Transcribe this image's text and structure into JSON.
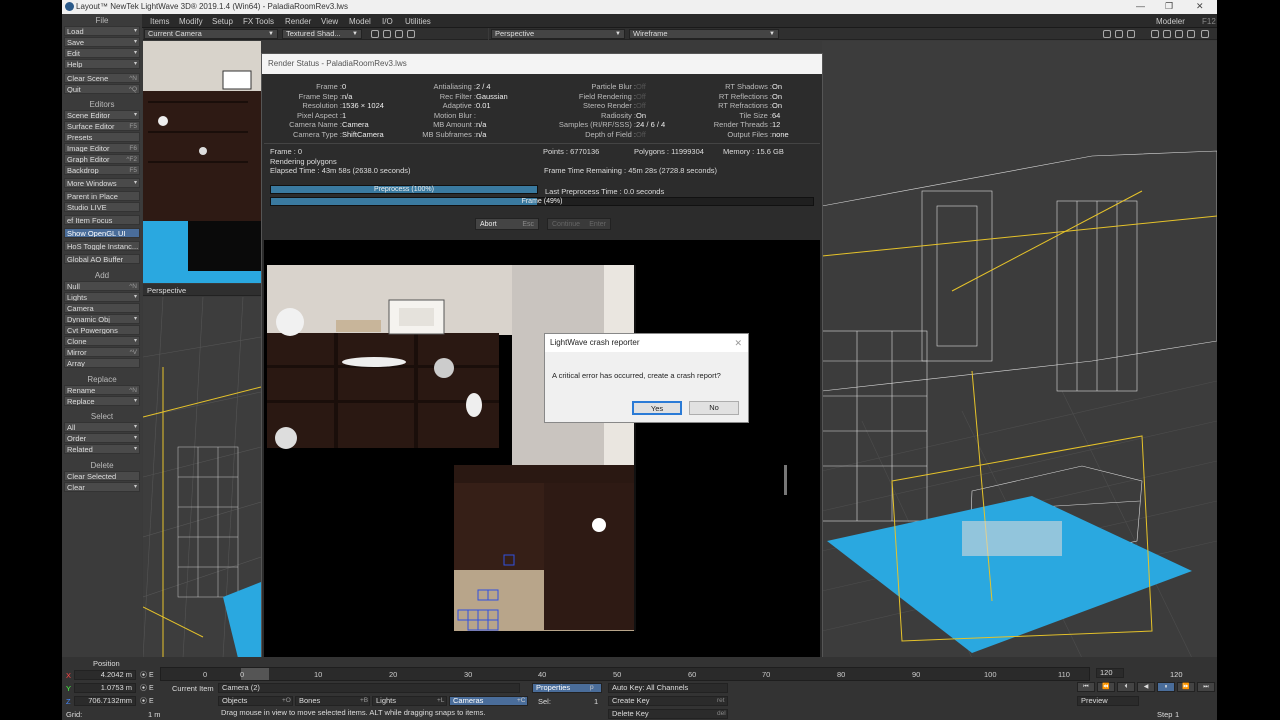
{
  "window": {
    "title": "Layout™ NewTek LightWave 3D® 2019.1.4 (Win64) - PaladiaRoomRev3.lws",
    "controls": [
      "—",
      "❐",
      "✕"
    ]
  },
  "menu": {
    "tabs": [
      "Items",
      "Modify",
      "Setup",
      "FX Tools",
      "Render",
      "View",
      "Model",
      "I/O",
      "Utilities"
    ],
    "active_tab": "Items",
    "modeler_label": "Modeler",
    "modeler_key": "F12"
  },
  "sidebar": {
    "file_title": "File",
    "file_items": [
      {
        "label": "Load",
        "key": "▾"
      },
      {
        "label": "Save",
        "key": "▾"
      },
      {
        "label": "Edit",
        "key": "▾"
      },
      {
        "label": "Help",
        "key": "▾"
      }
    ],
    "clear_scene": {
      "label": "Clear Scene",
      "key": "^N"
    },
    "quit": {
      "label": "Quit",
      "key": "^Q"
    },
    "editors_title": "Editors",
    "editor_items": [
      {
        "label": "Scene Editor",
        "key": "▾"
      },
      {
        "label": "Surface Editor",
        "key": "F5"
      },
      {
        "label": "Presets",
        "key": ""
      },
      {
        "label": "Image Editor",
        "key": "F6"
      },
      {
        "label": "Graph Editor",
        "key": "^F2"
      },
      {
        "label": "Backdrop",
        "key": "F5"
      },
      {
        "label": "More Windows",
        "key": "▾"
      }
    ],
    "misc_items": [
      {
        "label": "Parent in Place",
        "key": ""
      },
      {
        "label": "Studio LIVE",
        "key": ""
      },
      {
        "label": "ef Item Focus",
        "key": ""
      },
      {
        "label": "Show OpenGL UI",
        "key": ""
      },
      {
        "label": "HoS Toggle Instanc...",
        "key": ""
      },
      {
        "label": "Global AO Buffer",
        "key": ""
      }
    ],
    "add_title": "Add",
    "add_items": [
      {
        "label": "Null",
        "key": "^N"
      },
      {
        "label": "Lights",
        "key": "▾"
      },
      {
        "label": "Camera",
        "key": ""
      },
      {
        "label": "Dynamic Obj",
        "key": "▾"
      },
      {
        "label": "Cvt Powergons",
        "key": ""
      },
      {
        "label": "Clone",
        "key": "▾"
      },
      {
        "label": "Mirror",
        "key": "^V"
      },
      {
        "label": "Array",
        "key": ""
      }
    ],
    "replace_title": "Replace",
    "replace_items": [
      {
        "label": "Rename",
        "key": "^N"
      },
      {
        "label": "Replace",
        "key": "▾"
      }
    ],
    "select_title": "Select",
    "select_items": [
      {
        "label": "All",
        "key": "▾"
      },
      {
        "label": "Order",
        "key": "▾"
      },
      {
        "label": "Related",
        "key": "▾"
      }
    ],
    "delete_title": "Delete",
    "delete_items": [
      {
        "label": "Clear Selected",
        "key": ""
      },
      {
        "label": "Clear",
        "key": "▾"
      }
    ]
  },
  "viewports": {
    "top_left_view": "Current Camera",
    "top_left_shading": "Textured Shad...",
    "bottom_left_view": "Perspective",
    "right_view": "Perspective",
    "right_shading": "Wireframe"
  },
  "render_status": {
    "title": "Render Status - PaladiaRoomRev3.lws",
    "col1": [
      {
        "k": "Frame :",
        "v": "0"
      },
      {
        "k": "Frame Step :",
        "v": "n/a"
      },
      {
        "k": "Resolution :",
        "v": "1536 × 1024"
      },
      {
        "k": "Pixel Aspect :",
        "v": "1"
      },
      {
        "k": "Camera Name :",
        "v": "Camera"
      },
      {
        "k": "Camera Type :",
        "v": "ShiftCamera"
      }
    ],
    "col2": [
      {
        "k": "Antialiasing :",
        "v": "2 / 4"
      },
      {
        "k": "Rec Filter :",
        "v": "Gaussian"
      },
      {
        "k": "Adaptive :",
        "v": "0.01"
      },
      {
        "k": "Motion Blur :",
        "v": ""
      },
      {
        "k": "MB Amount :",
        "v": "n/a"
      },
      {
        "k": "MB Subframes :",
        "v": "n/a"
      }
    ],
    "col3": [
      {
        "k": "Particle Blur :",
        "v": "Off"
      },
      {
        "k": "Field Rendering :",
        "v": "Off"
      },
      {
        "k": "Stereo Render :",
        "v": "Off"
      },
      {
        "k": "Radiosity :",
        "v": "On"
      },
      {
        "k": "Samples (RI/RF/SSS) :",
        "v": "24 / 6 / 4"
      },
      {
        "k": "Depth of Field :",
        "v": "Off"
      }
    ],
    "col4": [
      {
        "k": "RT Shadows :",
        "v": "On"
      },
      {
        "k": "RT Reflections :",
        "v": "On"
      },
      {
        "k": "RT Refractions :",
        "v": "On"
      },
      {
        "k": "Tile Size :",
        "v": "64"
      },
      {
        "k": "Render Threads :",
        "v": "12"
      },
      {
        "k": "Output Files :",
        "v": "none"
      }
    ],
    "frame_line": "Frame : 0",
    "points": "Points : 6770136",
    "polygons": "Polygons : 11999304",
    "memory": "Memory : 15.6 GB",
    "stage": "Rendering polygons",
    "elapsed": "Elapsed Time : 43m 58s (2638.0 seconds)",
    "remaining": "Frame Time Remaining : 45m 28s (2728.8 seconds)",
    "last_preprocess": "Last Preprocess Time : 0.0 seconds",
    "preprocess_label": "Preprocess (100%)",
    "preprocess_progress": 1.0,
    "frame_label": "Frame (49%)",
    "frame_progress": 0.49,
    "abort_label": "Abort",
    "abort_key": "Esc",
    "continue_label": "Continue",
    "continue_key": "Enter"
  },
  "crash_dialog": {
    "title": "LightWave crash reporter",
    "message": "A critical error has occurred, create a crash report?",
    "yes_label": "Yes",
    "no_label": "No"
  },
  "bottom": {
    "position_label": "Position",
    "x_axis": "X",
    "y_axis": "Y",
    "z_axis": "Z",
    "x_value": "4.2042 m",
    "y_value": "1.0753 m",
    "z_value": "706.7132mm",
    "grid_label": "Grid:",
    "grid_value": "1 m",
    "current_item_label": "Current Item",
    "current_item_value": "Camera (2)",
    "objects_label": "Objects",
    "objects_key": "+O",
    "bones_label": "Bones",
    "bones_key": "+B",
    "lights_label": "Lights",
    "lights_key": "+L",
    "cameras_label": "Cameras",
    "cameras_key": "+C",
    "properties_label": "Properties",
    "properties_key": "p",
    "sel_label": "Sel:",
    "sel_value": "1",
    "autokey_label": "Auto Key: All Channels",
    "create_key_label": "Create Key",
    "create_key_key": "ret",
    "delete_key_label": "Delete Key",
    "delete_key_key": "del",
    "status_msg": "Drag mouse in view to move selected items. ALT while dragging snaps to items.",
    "timeline_start": "0",
    "timeline_ticks": [
      "0",
      "10",
      "20",
      "30",
      "40",
      "50",
      "60",
      "70",
      "80",
      "90",
      "100",
      "110",
      "120"
    ],
    "timeline_end": "120",
    "preview_label": "Preview",
    "step_label": "Step",
    "step_value": "1"
  }
}
